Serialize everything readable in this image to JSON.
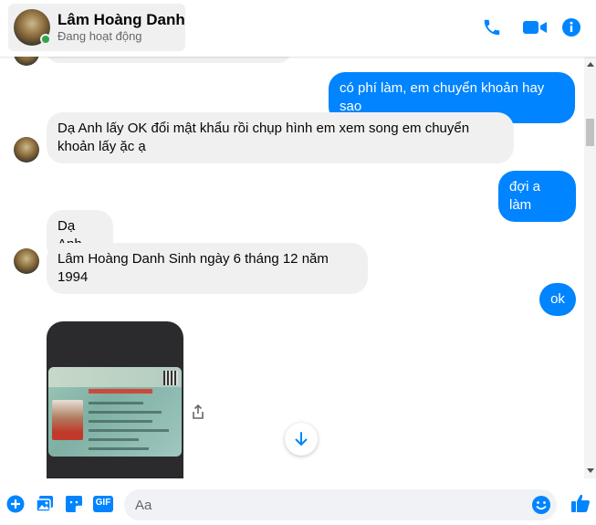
{
  "header": {
    "contact_name": "Lâm Hoàng Danh",
    "status": "Đang hoạt động",
    "icons": [
      "phone-icon",
      "video-call-icon",
      "info-icon"
    ]
  },
  "messages": [
    {
      "from": "me",
      "text": "có phí làm, em chuyển khoản hay sao"
    },
    {
      "from": "contact",
      "text": "Dạ Anh lấy OK đổi mật khẩu rồi chụp hình em xem song em chuyển khoản lấy ặc ạ"
    },
    {
      "from": "me",
      "text": "đợi a làm"
    },
    {
      "from": "contact",
      "text": "Dạ Anh"
    },
    {
      "from": "contact",
      "text": "Lâm Hoàng Danh Sinh ngày 6 tháng 12 năm 1994"
    },
    {
      "from": "me",
      "text": "ok"
    }
  ],
  "composer": {
    "placeholder": "Aa",
    "icons": [
      "plus-icon",
      "photo-icon",
      "sticker-icon",
      "gif-icon",
      "emoji-icon",
      "like-icon"
    ],
    "gif_label": "GIF"
  },
  "colors": {
    "accent": "#0084ff",
    "incoming_bubble": "#f0f0f0",
    "online": "#31a24c"
  }
}
